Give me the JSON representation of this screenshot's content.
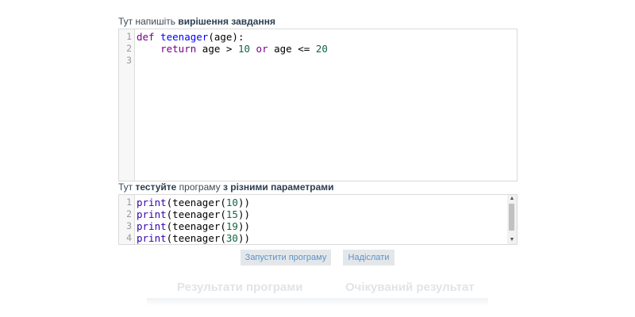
{
  "label_solution": {
    "prefix": "Тут напишіть ",
    "bold": "вирішення завдання"
  },
  "label_test": {
    "p1": "Тут ",
    "b1": "тестуйте",
    "p2": " програму ",
    "b2": "з різними параметрами"
  },
  "editor_solution": {
    "line_numbers": [
      "1",
      "2",
      "3"
    ],
    "line1": {
      "kw": "def",
      "name": "teenager",
      "rest": "(age):"
    },
    "line2": {
      "indent": "    ",
      "kw_return": "return",
      "t1": " age > ",
      "n1": "10",
      "t2": " ",
      "kw_or": "or",
      "t3": " age <= ",
      "n2": "20"
    }
  },
  "editor_test": {
    "line_numbers": [
      "1",
      "2",
      "3",
      "4"
    ],
    "lines": [
      {
        "fn": "print",
        "open": "(teenager(",
        "num": "10",
        "close": "))"
      },
      {
        "fn": "print",
        "open": "(teenager(",
        "num": "15",
        "close": "))"
      },
      {
        "fn": "print",
        "open": "(teenager(",
        "num": "19",
        "close": "))"
      },
      {
        "fn": "print",
        "open": "(teenager(",
        "num": "30",
        "close": "))"
      }
    ]
  },
  "buttons": {
    "run": "Запустити програму",
    "send": "Надіслати"
  },
  "results": {
    "program": "Результати програми",
    "expected": "Очікуваний результат"
  },
  "colors": {
    "keyword": "#770088",
    "def_name": "#0000ff",
    "number": "#116644",
    "button_text": "#5b93c5",
    "button_bg": "#e4e7ea"
  }
}
